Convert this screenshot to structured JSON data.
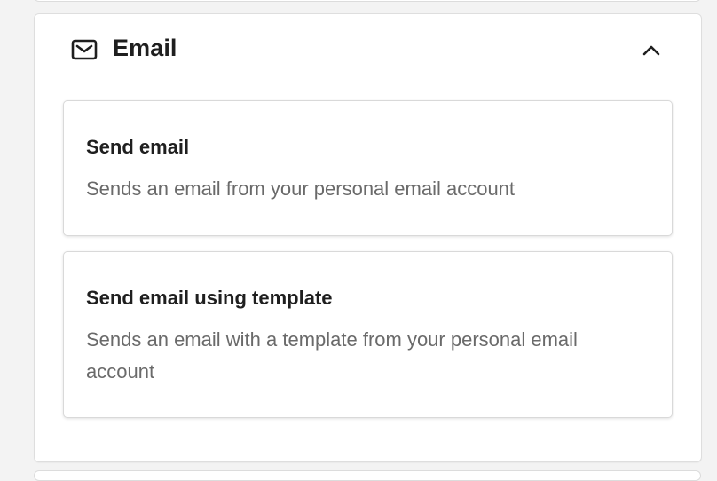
{
  "section": {
    "title": "Email",
    "icon": "mail-icon",
    "toggle_icon": "chevron-up-icon",
    "expanded": true
  },
  "actions": [
    {
      "title": "Send email",
      "description": "Sends an email from your personal email account"
    },
    {
      "title": "Send email using template",
      "description": "Sends an email with a template from your personal email account"
    }
  ],
  "colors": {
    "background": "#f3f3f3",
    "panel": "#ffffff",
    "title_text": "#1f1f1f",
    "description_text": "#6a6a6a",
    "border": "#d9d9d9"
  }
}
